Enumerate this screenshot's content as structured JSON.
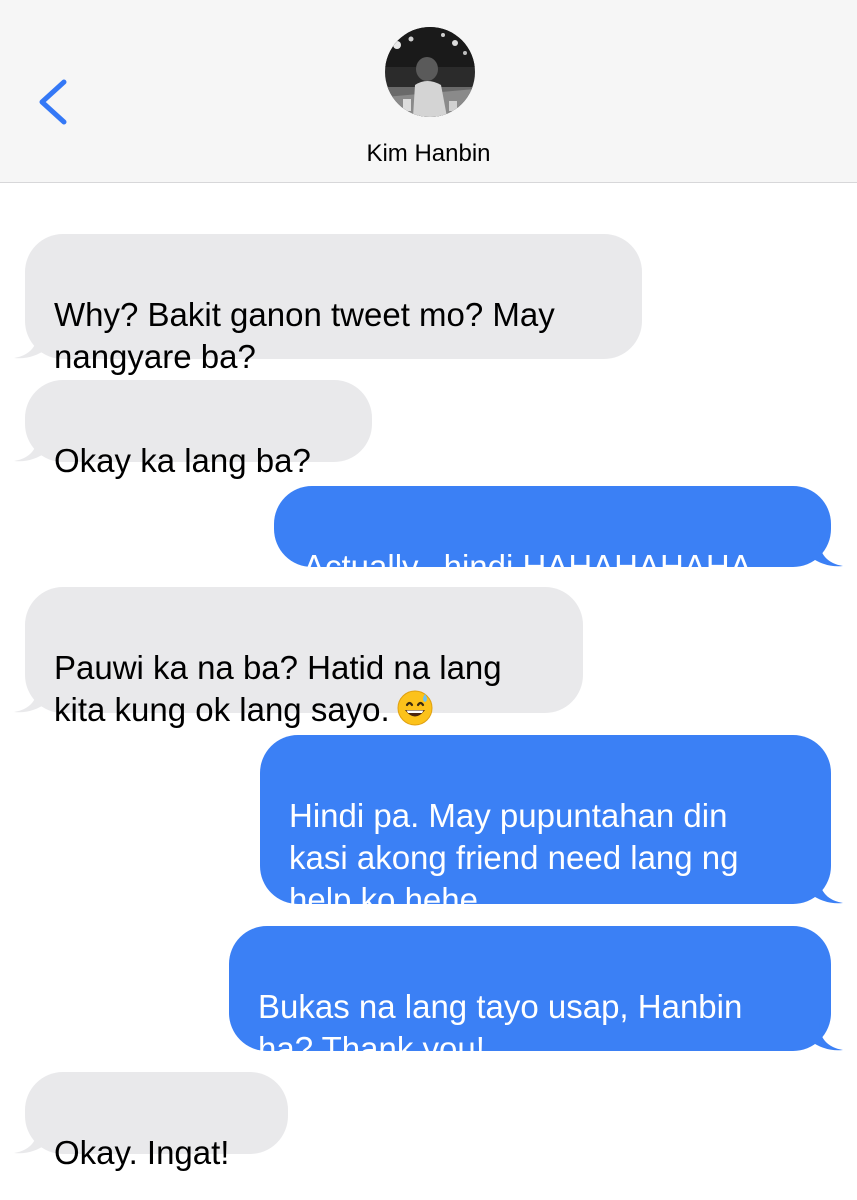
{
  "header": {
    "contact_name": "Kim Hanbin"
  },
  "messages": [
    {
      "direction": "incoming",
      "text": "Why? Bakit ganon tweet mo? May\nnangyare ba?"
    },
    {
      "direction": "incoming",
      "text": "Okay ka lang ba?"
    },
    {
      "direction": "outgoing",
      "text": "Actually.. hindi HAHAHAHAHA"
    },
    {
      "direction": "incoming",
      "text": "Pauwi ka na ba? Hatid na lang\nkita kung ok lang sayo.",
      "emoji": "grinning-face-with-sweat"
    },
    {
      "direction": "outgoing",
      "text": "Hindi pa. May pupuntahan din\nkasi akong friend need lang ng\nhelp ko hehe"
    },
    {
      "direction": "outgoing",
      "text": "Bukas na lang tayo usap, Hanbin\nha? Thank you!"
    },
    {
      "direction": "incoming",
      "text": "Okay. Ingat!"
    }
  ],
  "colors": {
    "incoming_bubble": "#e9e9eb",
    "outgoing_bubble": "#3b80f5",
    "accent": "#3478f6",
    "header_bg": "#f6f6f6"
  }
}
